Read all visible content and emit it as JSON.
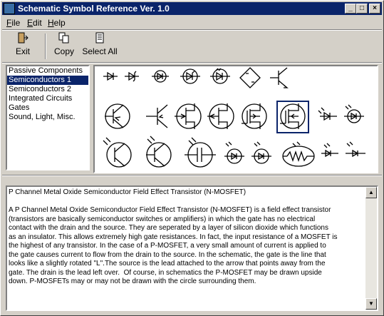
{
  "window": {
    "title": "Schematic Symbol Reference Ver. 1.0"
  },
  "menu": [
    {
      "label_u": "F",
      "label_rest": "ile"
    },
    {
      "label_u": "E",
      "label_rest": "dit"
    },
    {
      "label_u": "H",
      "label_rest": "elp"
    }
  ],
  "toolbar": {
    "exit": "Exit",
    "copy": "Copy",
    "select_all": "Select All"
  },
  "categories": [
    "Passive Components",
    "Semiconductors 1",
    "Semiconductors 2",
    "Integrated Circuits",
    "Gates",
    "Sound, Light, Misc."
  ],
  "selected_category": "Semiconductors 1",
  "symbols": [
    "diode-icon",
    "diode-icon",
    "transistor-circle-icon",
    "diode-circle-icon",
    "zener-circle-icon",
    "bridge-rectifier-icon",
    "npn-transistor-icon",
    "npn-circle-icon",
    "pnp-transistor-icon",
    "jfet-circle-icon",
    "jfet-p-circle-icon",
    "n-mosfet-icon",
    "p-mosfet-icon",
    "led-icon",
    "led-circle-icon",
    "phototransistor-icon",
    "photo-transistor-icon",
    "photo-fet-icon",
    "photodiode-icon",
    "photodiode-circle-icon",
    "photocell-icon",
    "photodiode-icon",
    "photodiode-icon"
  ],
  "selected_symbol": "p-mosfet-icon",
  "description": {
    "heading": "P Channel Metal Oxide Semiconductor Field Effect Transistor (N-MOSFET)",
    "body": "A P Channel Metal Oxide Semiconductor Field Effect Transistor (N-MOSFET) is a field effect transistor\n(transistors are basically semiconductor switches or amplifiers) in which the gate has no electrical\ncontact with the drain and the source. They are seperated by a layer of silicon dioxide which functions\nas an insulator. This allows extremely high gate resistances. In fact, the input resistance of a MOSFET is\nthe highest of any transistor. In the case of a P-MOSFET, a very small amount of current is applied to\nthe gate causes current to flow from the drain to the source. In the schematic, the gate is the line that\nlooks like a slightly rotated \"L\".The source is the lead attached to the arrow that points away from the\ngate. The drain is the lead left over.  Of course, in schematics the P-MOSFET may be drawn upside\ndown. P-MOSFETs may or may not be drawn with the circle surrounding them."
  }
}
